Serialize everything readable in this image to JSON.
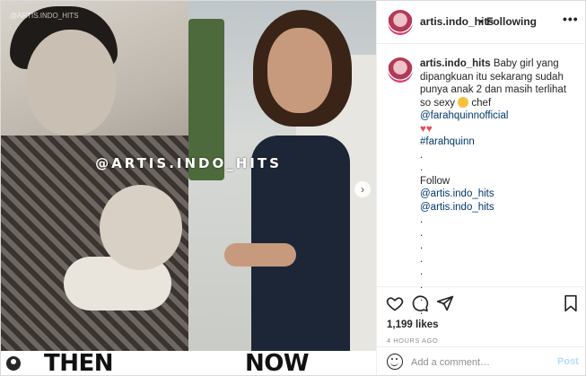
{
  "media": {
    "watermark": "@ARTIS.INDO_HITS",
    "small_mark": "@ARTIS.INDO_HITS",
    "left_label": "THEN",
    "right_label": "NOW",
    "next_icon": "chevron-right-icon"
  },
  "header": {
    "username": "artis.indo_hits",
    "separator": "•",
    "follow_status": "Following",
    "more_label": "•••"
  },
  "post": {
    "username": "artis.indo_hits",
    "caption_text": "Baby girl yang dipangkuan itu sekarang sudah punya anak 2 dan masih terlihat so sexy",
    "caption_mid": "chef",
    "mention_1": "@farahquinnofficial",
    "hearts": "♥♥",
    "hashtag": "#farahquinn",
    "dots_before_follow": [
      ".",
      "."
    ],
    "follow_word": "Follow",
    "follow_mention_1": "@artis.indo_hits",
    "follow_mention_2": "@artis.indo_hits",
    "dots_after": [
      ".",
      ".",
      ".",
      ".",
      ".",
      ".",
      ".",
      "."
    ]
  },
  "actions": {
    "like_icon": "heart-icon",
    "comment_icon": "comment-icon",
    "share_icon": "share-icon",
    "save_icon": "bookmark-icon",
    "likes": "1,199 likes",
    "time": "4 HOURS AGO"
  },
  "comment_box": {
    "placeholder": "Add a comment…",
    "post_label": "Post"
  },
  "colors": {
    "link": "#00376b",
    "post_disabled": "#b2dffc",
    "heart": "#ed4956"
  }
}
